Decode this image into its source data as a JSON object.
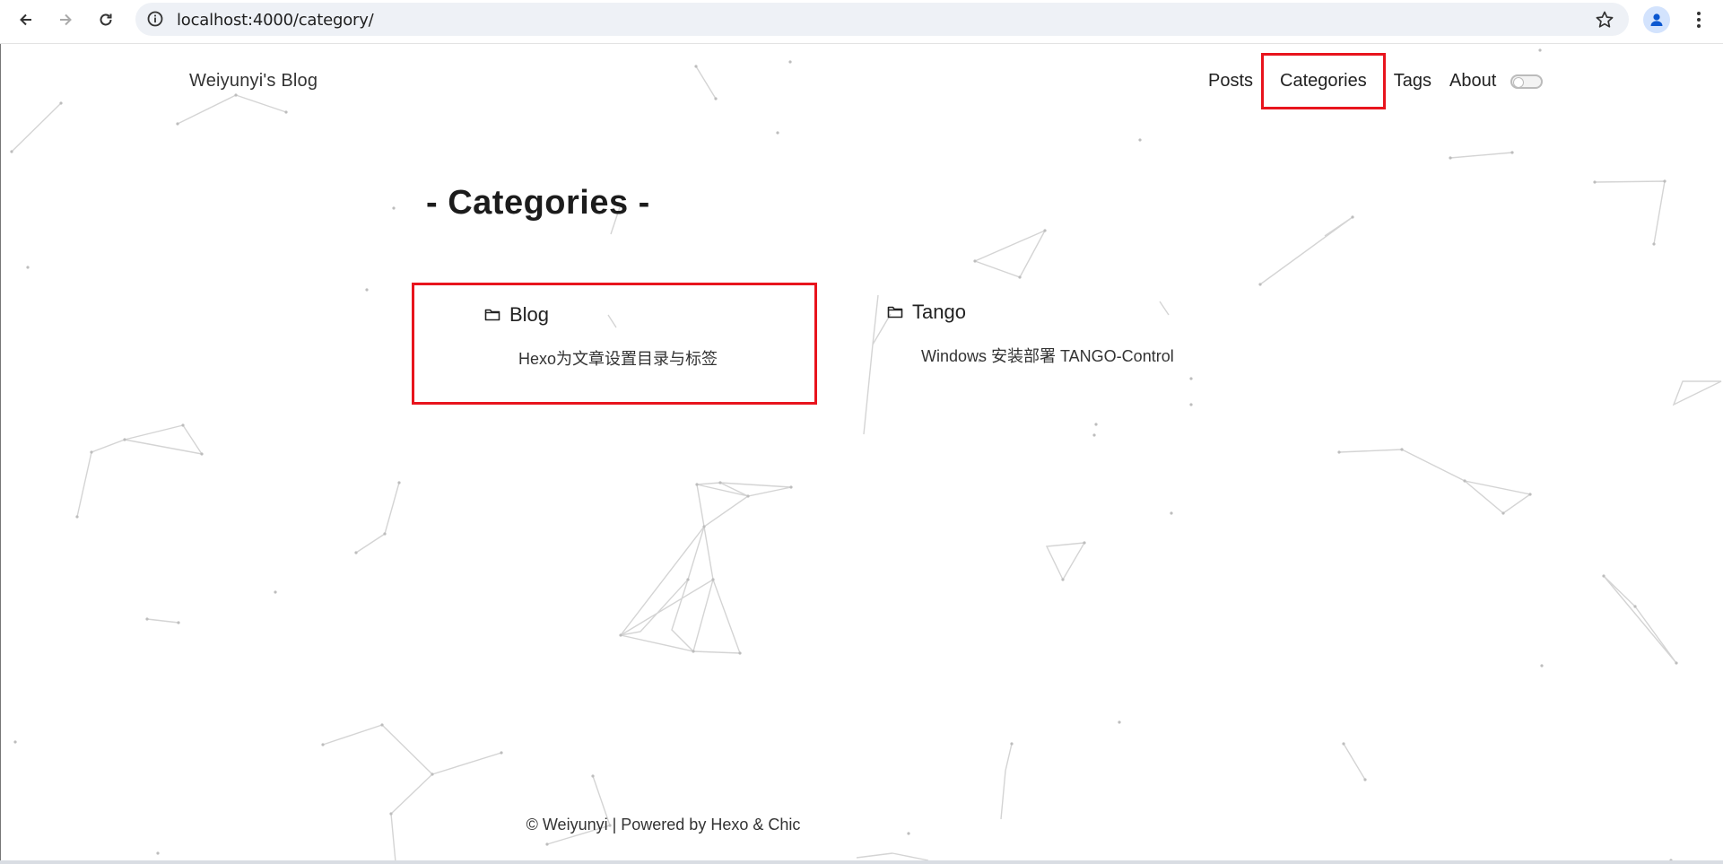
{
  "browser": {
    "url": "localhost:4000/category/",
    "back_icon": "arrow-left-icon",
    "forward_icon": "arrow-right-icon",
    "reload_icon": "reload-icon",
    "info_icon": "info-icon",
    "bookmark_icon": "star-icon",
    "profile_icon": "person-icon",
    "menu_icon": "kebab-menu-icon"
  },
  "site": {
    "title": "Weiyunyi's Blog"
  },
  "nav": {
    "items": [
      {
        "label": "Posts"
      },
      {
        "label": "Categories",
        "highlighted": true
      },
      {
        "label": "Tags"
      },
      {
        "label": "About"
      }
    ],
    "theme_toggle": "off"
  },
  "page": {
    "title": "- Categories -"
  },
  "categories": [
    {
      "name": "Blog",
      "icon": "folder-icon",
      "posts": [
        "Hexo为文章设置目录与标签"
      ],
      "highlighted": true
    },
    {
      "name": "Tango",
      "icon": "folder-icon",
      "posts": [
        "Windows 安装部署 TANGO-Control"
      ]
    }
  ],
  "footer": {
    "text": "© Weiyunyi | Powered by Hexo & Chic"
  },
  "colors": {
    "highlight": "#e8141d",
    "particles": "#cfcfcf",
    "omnibox": "#eef1f6"
  }
}
